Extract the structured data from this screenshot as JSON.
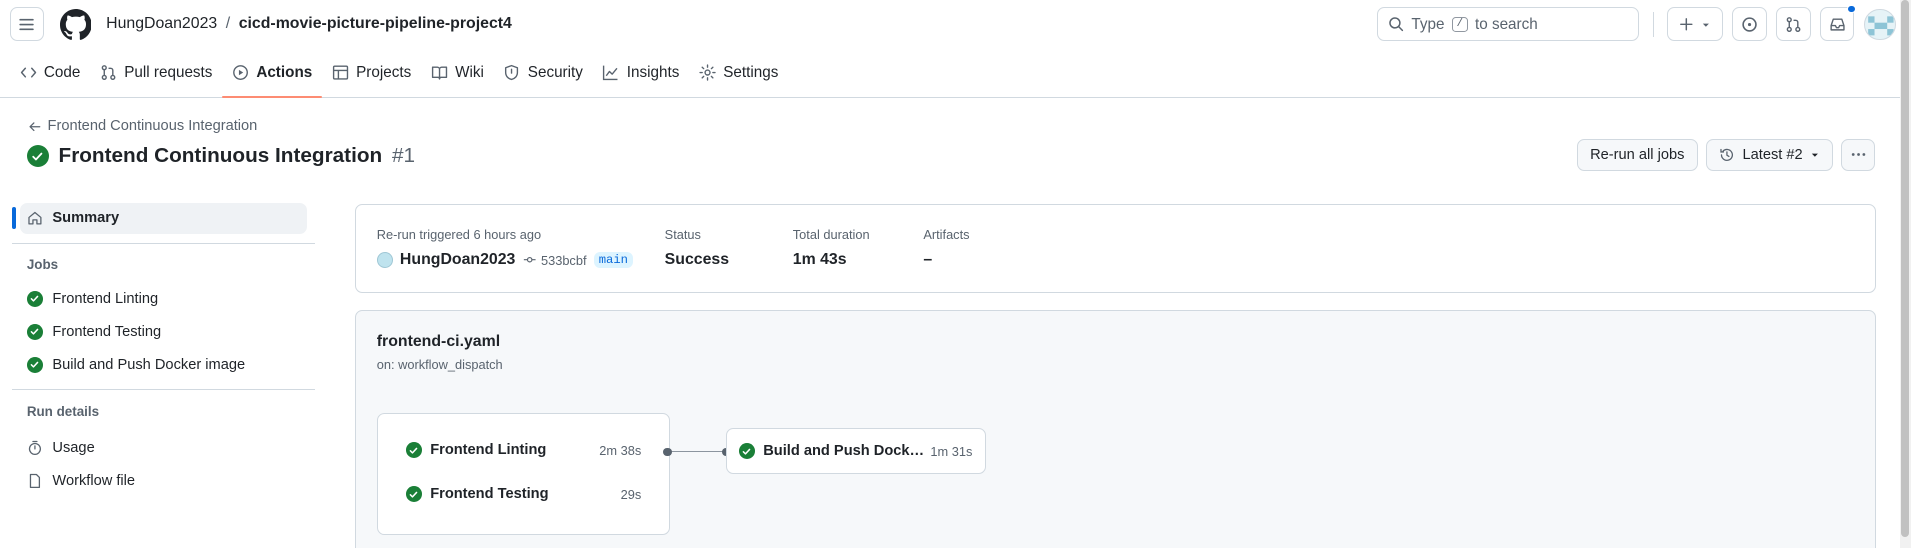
{
  "header": {
    "owner": "HungDoan2023",
    "separator": "/",
    "repo": "cicd-movie-picture-pipeline-project4",
    "search_prefix": "Type",
    "search_key": "/",
    "search_suffix": "to search"
  },
  "tabs": [
    {
      "label": "Code",
      "icon": "code-icon"
    },
    {
      "label": "Pull requests",
      "icon": "pull-request-icon"
    },
    {
      "label": "Actions",
      "icon": "play-icon",
      "active": true
    },
    {
      "label": "Projects",
      "icon": "table-icon"
    },
    {
      "label": "Wiki",
      "icon": "book-icon"
    },
    {
      "label": "Security",
      "icon": "shield-icon"
    },
    {
      "label": "Insights",
      "icon": "graph-icon"
    },
    {
      "label": "Settings",
      "icon": "gear-icon"
    }
  ],
  "run": {
    "back_label": "Frontend Continuous Integration",
    "title": "Frontend Continuous Integration",
    "number": "#1",
    "rerun_label": "Re-run all jobs",
    "latest_label": "Latest #2"
  },
  "sidebar": {
    "summary_label": "Summary",
    "jobs_heading": "Jobs",
    "jobs": [
      "Frontend Linting",
      "Frontend Testing",
      "Build and Push Docker image"
    ],
    "run_details_heading": "Run details",
    "usage_label": "Usage",
    "workflow_file_label": "Workflow file"
  },
  "summary": {
    "trigger_label": "Re-run triggered 6 hours ago",
    "actor": "HungDoan2023",
    "commit": "533bcbf",
    "branch": "main",
    "status_label": "Status",
    "status_value": "Success",
    "duration_label": "Total duration",
    "duration_value": "1m 43s",
    "artifacts_label": "Artifacts",
    "artifacts_value": "–"
  },
  "workflow": {
    "file": "frontend-ci.yaml",
    "trigger": "on: workflow_dispatch",
    "group_jobs": [
      {
        "name": "Frontend Linting",
        "duration": "2m 38s"
      },
      {
        "name": "Frontend Testing",
        "duration": "29s"
      }
    ],
    "next_job": {
      "name": "Build and Push Docker image",
      "duration": "1m 31s"
    }
  },
  "colors": {
    "success": "#1a7f37",
    "accent": "#0969da",
    "tab_underline": "#fd8c73"
  }
}
